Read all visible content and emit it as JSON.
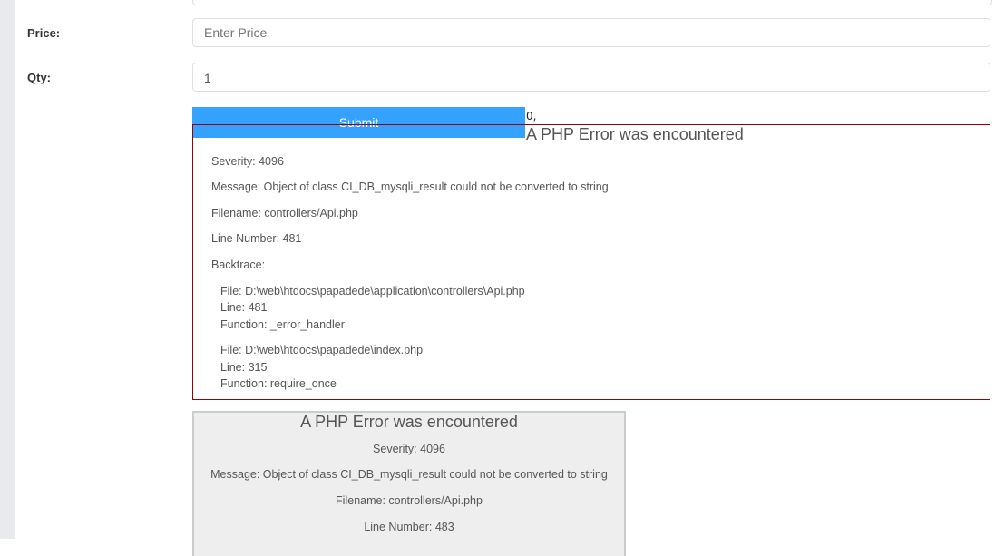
{
  "form": {
    "price_label": "Price:",
    "price_placeholder": "Enter Price",
    "price_value": "",
    "qty_label": "Qty:",
    "qty_value": "1",
    "submit_label": "Submit"
  },
  "output": {
    "raw_text": "0,"
  },
  "error1": {
    "heading": "A PHP Error was encountered",
    "severity": "Severity: 4096",
    "message": "Message: Object of class CI_DB_mysqli_result could not be converted to string",
    "filename": "Filename: controllers/Api.php",
    "line_number": "Line Number: 481",
    "backtrace_label": "Backtrace:",
    "backtrace": [
      {
        "file": "File: D:\\web\\htdocs\\papadede\\application\\controllers\\Api.php",
        "line": "Line: 481",
        "function": "Function: _error_handler"
      },
      {
        "file": "File: D:\\web\\htdocs\\papadede\\index.php",
        "line": "Line: 315",
        "function": "Function: require_once"
      }
    ]
  },
  "error2": {
    "heading": "A PHP Error was encountered",
    "severity": "Severity: 4096",
    "message": "Message: Object of class CI_DB_mysqli_result could not be converted to string",
    "filename": "Filename: controllers/Api.php",
    "line_number": "Line Number: 483"
  },
  "colors": {
    "submit_bg": "#35a2ff",
    "error_border": "#990000",
    "error2_bg": "#eeeeee"
  }
}
